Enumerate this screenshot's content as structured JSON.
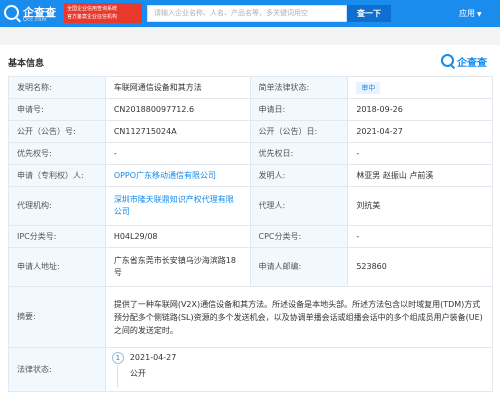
{
  "header": {
    "brand": "企查查",
    "domain": "Qcc.com",
    "promo_line1": "全国企业信用查询系统",
    "promo_line2": "官方备案企业征信机构",
    "search_placeholder": "请输入企业名称、人名、产品名等，多关键词用空",
    "search_button": "查一下",
    "app_menu": "应用",
    "colors": {
      "bar": "#1a8cee",
      "accent": "#128bed",
      "promo": "#e8392c"
    }
  },
  "section": {
    "title": "基本信息",
    "watermark": "企查查"
  },
  "fields": {
    "invention_name_label": "发明名称:",
    "invention_name": "车联网通信设备和其方法",
    "legal_status_label": "简单法律状态:",
    "legal_status": "审中",
    "app_no_label": "申请号:",
    "app_no": "CN201880097712.6",
    "app_date_label": "申请日:",
    "app_date": "2018-09-26",
    "pub_no_label": "公开（公告）号:",
    "pub_no": "CN112715024A",
    "pub_date_label": "公开（公告）日:",
    "pub_date": "2021-04-27",
    "priority_no_label": "优先权号:",
    "priority_no": "-",
    "priority_date_label": "优先权日:",
    "priority_date": "-",
    "applicant_label": "申请（专利权）人:",
    "applicant": "OPPO广东移动通信有限公司",
    "inventor_label": "发明人:",
    "inventor": "林亚男 赵振山 卢前溪",
    "agency_label": "代理机构:",
    "agency": "深圳市隆天联鼎知识产权代理有限公司",
    "agent_label": "代理人:",
    "agent": "刘抗美",
    "ipc_label": "IPC分类号:",
    "ipc": "H04L29/08",
    "cpc_label": "CPC分类号:",
    "cpc": "-",
    "address_label": "申请人地址:",
    "address": "广东省东莞市长安镇乌沙海滨路18号",
    "postcode_label": "申请人邮编:",
    "postcode": "523860",
    "abstract_label": "摘要:",
    "abstract": "提供了一种车联网(V2X)通信设备和其方法。所述设备是本地头部。所述方法包含以时域复用(TDM)方式预分配多个侧链路(SL)资源的多个发送机会，以及协调单播会话或组播会话中的多个组成员用户装备(UE)之间的发送定时。",
    "law_status_label": "法律状态:",
    "law_status_entries": [
      {
        "index": "1",
        "date": "2021-04-27",
        "status": "公开"
      }
    ]
  }
}
